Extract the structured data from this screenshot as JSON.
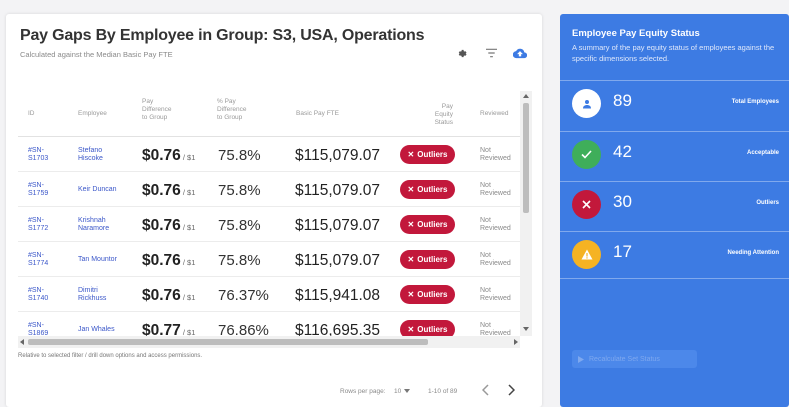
{
  "main": {
    "title": "Pay Gaps By Employee in Group: S3, USA, Operations",
    "subtitle": "Calculated against the Median Basic Pay FTE",
    "icons": [
      "gear-icon",
      "filter-icon",
      "cloud-upload-icon"
    ]
  },
  "table": {
    "headers": {
      "id": "ID",
      "employee": "Employee",
      "pay_diff": [
        "Pay",
        "Difference",
        "to Group"
      ],
      "pct_diff": [
        "% Pay",
        "Difference",
        "to Group"
      ],
      "basic_pay": "Basic Pay FTE",
      "status": [
        "Pay Equity",
        "Status"
      ],
      "reviewed": "Reviewed"
    },
    "rows": [
      {
        "id": [
          "#SN-",
          "S1703"
        ],
        "employee": [
          "Stefano",
          "Hiscoke"
        ],
        "diff": "$0.76",
        "unit": " / $1",
        "pct": "75.8%",
        "fte": "$115,079.07",
        "status": "Outliers",
        "reviewed": [
          "Not",
          "Reviewed"
        ]
      },
      {
        "id": [
          "#SN-",
          "S1759"
        ],
        "employee": [
          "Keir Duncan"
        ],
        "diff": "$0.76",
        "unit": " / $1",
        "pct": "75.8%",
        "fte": "$115,079.07",
        "status": "Outliers",
        "reviewed": [
          "Not",
          "Reviewed"
        ]
      },
      {
        "id": [
          "#SN-",
          "S1772"
        ],
        "employee": [
          "Krishnah",
          "Naramore"
        ],
        "diff": "$0.76",
        "unit": " / $1",
        "pct": "75.8%",
        "fte": "$115,079.07",
        "status": "Outliers",
        "reviewed": [
          "Not",
          "Reviewed"
        ]
      },
      {
        "id": [
          "#SN-",
          "S1774"
        ],
        "employee": [
          "Tan Mountor"
        ],
        "diff": "$0.76",
        "unit": " / $1",
        "pct": "75.8%",
        "fte": "$115,079.07",
        "status": "Outliers",
        "reviewed": [
          "Not",
          "Reviewed"
        ]
      },
      {
        "id": [
          "#SN-",
          "S1740"
        ],
        "employee": [
          "Dimitri",
          "Rickhuss"
        ],
        "diff": "$0.76",
        "unit": " / $1",
        "pct": "76.37%",
        "fte": "$115,941.08",
        "status": "Outliers",
        "reviewed": [
          "Not",
          "Reviewed"
        ]
      },
      {
        "id": [
          "#SN-",
          "S1869"
        ],
        "employee": [
          "Jan Whales"
        ],
        "diff": "$0.77",
        "unit": " / $1",
        "pct": "76.86%",
        "fte": "$116,695.35",
        "status": "Outliers",
        "reviewed": [
          "Not",
          "Reviewed"
        ]
      }
    ]
  },
  "footnote": "Relative to selected filter / drill down options and access permissions.",
  "pagination": {
    "rows_per_page_label": "Rows per page:",
    "rows_per_page_value": "10",
    "range": "1-10 of 89"
  },
  "panel": {
    "title": "Employee Pay Equity Status",
    "description": "A summary of the pay equity status of employees against the specific dimensions selected.",
    "stats": [
      {
        "value": "89",
        "label": "Total Employees",
        "icon": "person-icon",
        "color": "#ffffff"
      },
      {
        "value": "42",
        "label": "Acceptable",
        "icon": "check-icon",
        "color": "#3fae5a"
      },
      {
        "value": "30",
        "label": "Outliers",
        "icon": "close-icon",
        "color": "#c2183b"
      },
      {
        "value": "17",
        "label": "Needing Attention",
        "icon": "warning-icon",
        "color": "#f5b323"
      }
    ],
    "button_label": "Recalculate Set Status"
  },
  "colors": {
    "accent": "#3d7be3",
    "outlier": "#c2183b",
    "link": "#3b57c9"
  }
}
